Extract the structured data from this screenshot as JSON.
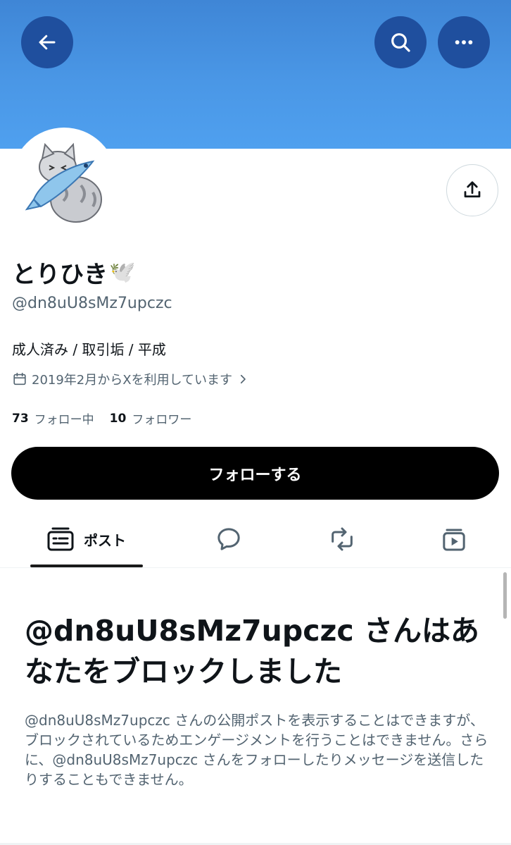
{
  "header": {
    "back_icon": "arrow-left-icon",
    "search_icon": "search-icon",
    "more_icon": "more-horizontal-icon"
  },
  "profile": {
    "display_name": "とりひき",
    "name_emoji": "🕊️",
    "handle": "@dn8uU8sMz7upczc",
    "bio": "成人済み / 取引垢 / 平成",
    "joined": "2019年2月からXを利用しています",
    "following_count": "73",
    "following_label": "フォロー中",
    "followers_count": "10",
    "followers_label": "フォロワー"
  },
  "actions": {
    "follow_label": "フォローする",
    "share_icon": "share-icon"
  },
  "tabs": [
    {
      "label": "ポスト",
      "icon": "posts-icon",
      "active": true
    },
    {
      "label": "",
      "icon": "reply-icon",
      "active": false
    },
    {
      "label": "",
      "icon": "repost-icon",
      "active": false
    },
    {
      "label": "",
      "icon": "media-icon",
      "active": false
    }
  ],
  "blocked": {
    "title": "@dn8uU8sMz7upczc さんはあなたをブロックしました",
    "description": "@dn8uU8sMz7upczc さんの公開ポストを表示することはできますが、ブロックされているためエンゲージメントを行うことはできません。さらに、@dn8uU8sMz7upczc さんをフォローしたりメッセージを送信したりすることもできません。"
  },
  "colors": {
    "banner": "#4a97e6",
    "header_button": "#1f4f9e",
    "follow_button": "#000000",
    "secondary_text": "#536471"
  }
}
